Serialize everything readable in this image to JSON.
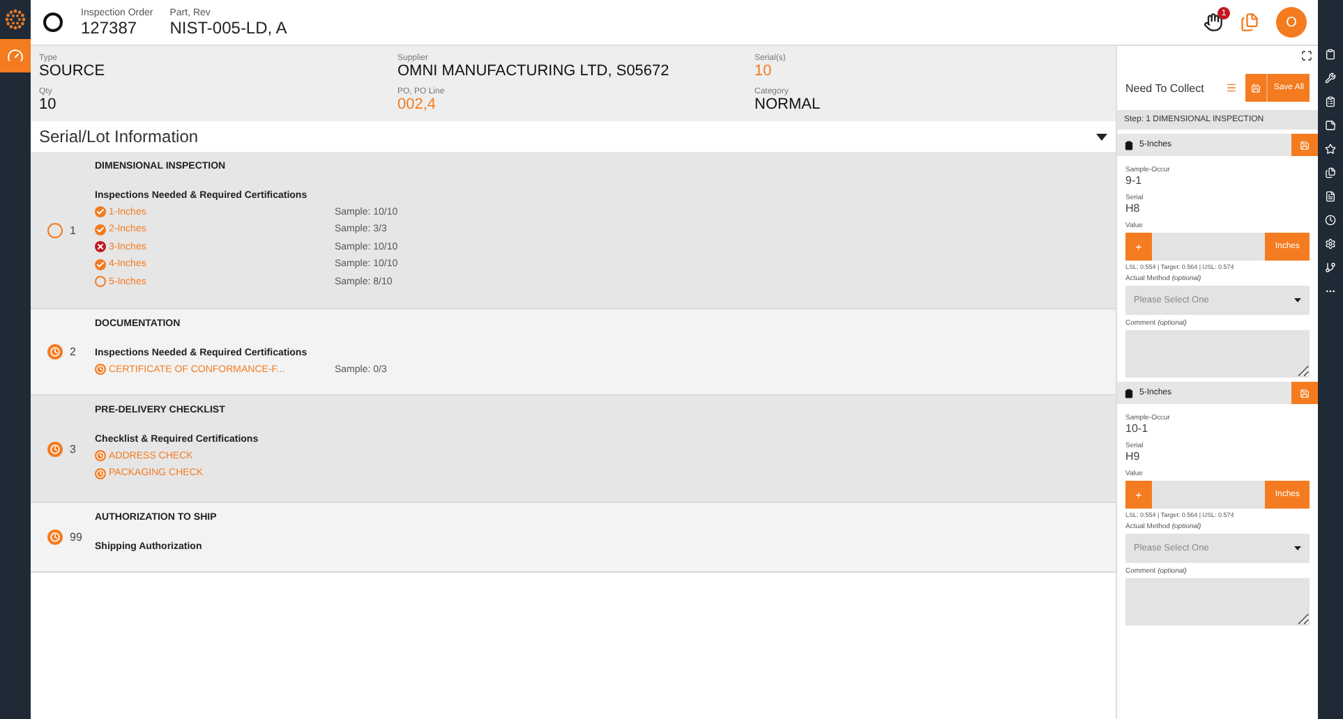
{
  "header": {
    "order_label": "Inspection Order",
    "order": "127387",
    "part_label": "Part, Rev",
    "part": "NIST-005-LD, A",
    "notification_count": "1",
    "avatar": "O"
  },
  "info": [
    {
      "label": "Type",
      "value": "SOURCE",
      "accent": false
    },
    {
      "label": "Supplier",
      "value": "OMNI MANUFACTURING LTD, S05672",
      "accent": false
    },
    {
      "label": "Serial(s)",
      "value": "10",
      "accent": true
    },
    {
      "label": "Qty",
      "value": "10",
      "accent": false
    },
    {
      "label": "PO, PO Line",
      "value": "002,4",
      "accent": true
    },
    {
      "label": "Category",
      "value": "NORMAL",
      "accent": false
    }
  ],
  "section_title": "Serial/Lot Information",
  "steps": [
    {
      "number": "1",
      "kind": "progress",
      "title": "DIMENSIONAL INSPECTION",
      "subtitle": "Inspections Needed & Required Certifications",
      "items": [
        {
          "kind": "done",
          "label": "1-Inches",
          "sample": "Sample: 10/10"
        },
        {
          "kind": "done",
          "label": "2-Inches",
          "sample": "Sample: 3/3"
        },
        {
          "kind": "failed",
          "label": "3-Inches",
          "sample": "Sample: 10/10"
        },
        {
          "kind": "done",
          "label": "4-Inches",
          "sample": "Sample: 10/10"
        },
        {
          "kind": "progress",
          "label": "5-Inches",
          "sample": "Sample: 8/10"
        }
      ]
    },
    {
      "number": "2",
      "kind": "pending",
      "title": "DOCUMENTATION",
      "subtitle": "Inspections Needed & Required Certifications",
      "items": [
        {
          "kind": "pending",
          "label": "CERTIFICATE OF CONFORMANCE-F...",
          "sample": "Sample: 0/3"
        }
      ]
    },
    {
      "number": "3",
      "kind": "pending",
      "title": "PRE-DELIVERY CHECKLIST",
      "subtitle": "Checklist & Required Certifications",
      "items": [
        {
          "kind": "pending",
          "label": "ADDRESS CHECK"
        },
        {
          "kind": "pending",
          "label": "PACKAGING CHECK"
        }
      ]
    },
    {
      "number": "99",
      "kind": "pending",
      "title": "AUTHORIZATION TO SHIP",
      "subtitle": "Shipping Authorization"
    }
  ],
  "collect": {
    "title": "Need To Collect",
    "save_all": "Save All",
    "step": "Step: 1 DIMENSIONAL INSPECTION",
    "cards": [
      {
        "name": "5-Inches",
        "sample_label": "Sample-Occur",
        "sample": "9-1",
        "serial_label": "Serial",
        "serial": "H8",
        "value_label": "Value",
        "plus": "+",
        "unit": "Inches",
        "limits": "LSL: 0.554 | Target: 0.564 | USL: 0.574",
        "method_label": "Actual Method",
        "method_hint": "(optional)",
        "method_placeholder": "Please Select One",
        "comment_label": "Comment",
        "comment_hint": "(optional)"
      },
      {
        "name": "5-Inches",
        "sample_label": "Sample-Occur",
        "sample": "10-1",
        "serial_label": "Serial",
        "serial": "H9",
        "value_label": "Value",
        "plus": "+",
        "unit": "Inches",
        "limits": "LSL: 0.554 | Target: 0.564 | USL: 0.574",
        "method_label": "Actual Method",
        "method_hint": "(optional)",
        "method_placeholder": "Please Select One",
        "comment_label": "Comment",
        "comment_hint": "(optional)"
      }
    ]
  }
}
